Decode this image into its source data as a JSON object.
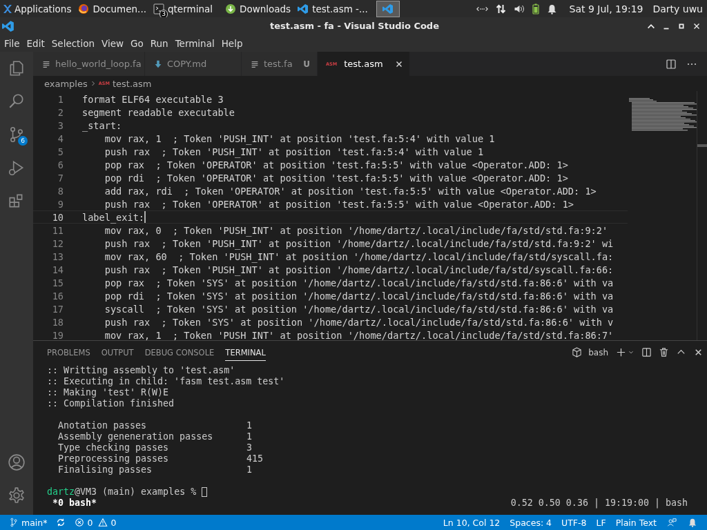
{
  "taskbar": {
    "apps_menu": "Applications",
    "tasks": [
      {
        "kind": "browser",
        "label": "Documen...",
        "selected": false
      },
      {
        "kind": "terminal",
        "label": "qterminal",
        "badge": "3",
        "selected": false
      },
      {
        "kind": "downloads",
        "label": "Downloads",
        "selected": false
      },
      {
        "kind": "code",
        "label": "test.asm -...",
        "selected": false
      },
      {
        "kind": "code",
        "selected": true
      }
    ],
    "clock": "Sat  9 Jul, 19:19",
    "user": "Darty uwu"
  },
  "window": {
    "title": "test.asm - fa - Visual Studio Code"
  },
  "menu": [
    "File",
    "Edit",
    "Selection",
    "View",
    "Go",
    "Run",
    "Terminal",
    "Help"
  ],
  "activity_bar": [
    {
      "kind": "files"
    },
    {
      "kind": "search"
    },
    {
      "kind": "source-control",
      "badge": "6"
    },
    {
      "kind": "run"
    },
    {
      "kind": "extensions"
    }
  ],
  "activity_bar_bottom": [
    {
      "kind": "account"
    },
    {
      "kind": "settings"
    }
  ],
  "tabs": [
    {
      "kind": "lines",
      "label": "hello_world_loop.fa",
      "selected": false
    },
    {
      "kind": "markdown",
      "label": "COPY.md",
      "selected": false
    },
    {
      "kind": "lines",
      "label": "test.fa",
      "status": "U",
      "selected": false
    },
    {
      "kind": "asm",
      "icon_label": "ASM",
      "label": "test.asm",
      "selected": true
    }
  ],
  "breadcrumb": [
    {
      "label": "examples"
    },
    {
      "label": "test.asm",
      "icon_label": "ASM"
    }
  ],
  "editor": {
    "lines": [
      {
        "number": "1",
        "text": "format ELF64 executable 3",
        "current": false
      },
      {
        "number": "2",
        "text": "segment readable executable",
        "current": false
      },
      {
        "number": "3",
        "text": "_start:",
        "current": false
      },
      {
        "number": "4",
        "text": "    mov rax, 1  ; Token 'PUSH_INT' at position 'test.fa:5:4' with value 1",
        "current": false
      },
      {
        "number": "5",
        "text": "    push rax  ; Token 'PUSH_INT' at position 'test.fa:5:4' with value 1",
        "current": false
      },
      {
        "number": "6",
        "text": "    pop rax  ; Token 'OPERATOR' at position 'test.fa:5:5' with value <Operator.ADD: 1>",
        "current": false
      },
      {
        "number": "7",
        "text": "    pop rdi  ; Token 'OPERATOR' at position 'test.fa:5:5' with value <Operator.ADD: 1>",
        "current": false
      },
      {
        "number": "8",
        "text": "    add rax, rdi  ; Token 'OPERATOR' at position 'test.fa:5:5' with value <Operator.ADD: 1>",
        "current": false
      },
      {
        "number": "9",
        "text": "    push rax  ; Token 'OPERATOR' at position 'test.fa:5:5' with value <Operator.ADD: 1>",
        "current": false
      },
      {
        "number": "10",
        "text": "label_exit:",
        "current": true
      },
      {
        "number": "11",
        "text": "    mov rax, 0  ; Token 'PUSH_INT' at position '/home/dartz/.local/include/fa/std/std.fa:9:2'",
        "current": false
      },
      {
        "number": "12",
        "text": "    push rax  ; Token 'PUSH_INT' at position '/home/dartz/.local/include/fa/std/std.fa:9:2' wi",
        "current": false
      },
      {
        "number": "13",
        "text": "    mov rax, 60  ; Token 'PUSH_INT' at position '/home/dartz/.local/include/fa/std/syscall.fa:",
        "current": false
      },
      {
        "number": "14",
        "text": "    push rax  ; Token 'PUSH_INT' at position '/home/dartz/.local/include/fa/std/syscall.fa:66:",
        "current": false
      },
      {
        "number": "15",
        "text": "    pop rax  ; Token 'SYS' at position '/home/dartz/.local/include/fa/std/std.fa:86:6' with va",
        "current": false
      },
      {
        "number": "16",
        "text": "    pop rdi  ; Token 'SYS' at position '/home/dartz/.local/include/fa/std/std.fa:86:6' with va",
        "current": false
      },
      {
        "number": "17",
        "text": "    syscall  ; Token 'SYS' at position '/home/dartz/.local/include/fa/std/std.fa:86:6' with va",
        "current": false
      },
      {
        "number": "18",
        "text": "    push rax  ; Token 'SYS' at position '/home/dartz/.local/include/fa/std/std.fa:86:6' with v",
        "current": false
      },
      {
        "number": "19",
        "text": "    mov rax, 1  ; Token 'PUSH_INT' at position '/home/dartz/.local/include/fa/std/std.fa:86:7'",
        "current": false
      }
    ]
  },
  "panel": {
    "tabs": [
      {
        "label": "PROBLEMS",
        "selected": false
      },
      {
        "label": "OUTPUT",
        "selected": false
      },
      {
        "label": "DEBUG CONSOLE",
        "selected": false
      },
      {
        "label": "TERMINAL",
        "selected": true
      }
    ],
    "terminal_name": "bash",
    "log": [
      ":: Writting assembly to 'test.asm'",
      ":: Executing in child: 'fasm test.asm test'",
      ":: Making 'test' R(W)E",
      ":: Compilation finished"
    ],
    "stats": [
      {
        "label": "Anotation passes",
        "value": "1"
      },
      {
        "label": "Assembly geneneration passes",
        "value": "1"
      },
      {
        "label": "Type checking passes",
        "value": "3"
      },
      {
        "label": "Preprocessing passes",
        "value": "415"
      },
      {
        "label": "Finalising passes",
        "value": "1"
      }
    ],
    "prompt": {
      "user": "dartz",
      "rest": "@VM3 (main) examples %"
    },
    "tmux_left": "*0 bash*",
    "tmux_right": "0.52 0.50 0.36 | 19:19:00 | bash"
  },
  "status_bar": {
    "branch": "main*",
    "errors": "0",
    "warnings": "0",
    "items": [
      "Ln 10, Col 12",
      "Spaces: 4",
      "UTF-8",
      "LF",
      "Plain Text"
    ]
  }
}
